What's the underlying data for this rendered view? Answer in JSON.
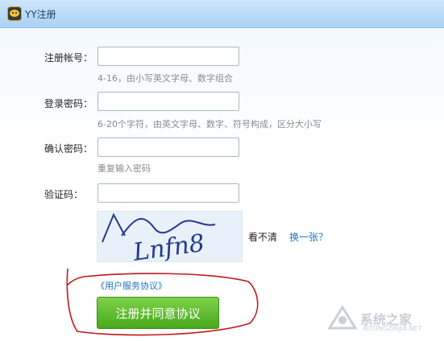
{
  "window": {
    "title": "YY注册"
  },
  "form": {
    "account": {
      "label": "注册帐号：",
      "value": "",
      "hint": "4-16，由小写英文字母、数字组合"
    },
    "password": {
      "label": "登录密码：",
      "value": "",
      "hint": "6-20个字符，由英文字母、数字、符号构成，区分大小写"
    },
    "confirm": {
      "label": "确认密码：",
      "value": "",
      "hint": "重复输入密码"
    },
    "captcha": {
      "label": "验证码：",
      "value": "",
      "image_text": "Lnfn8",
      "unclear": "看不清",
      "refresh": "换一张？"
    }
  },
  "agreement_link": "《用户服务协议》",
  "submit_label": "注册并同意协议",
  "watermark": {
    "text": "系统之家",
    "url": "XITONGZHIJIA.NET"
  },
  "colors": {
    "link": "#1d72c9",
    "button": "#5bbf2a",
    "annotation": "#c2181a"
  }
}
